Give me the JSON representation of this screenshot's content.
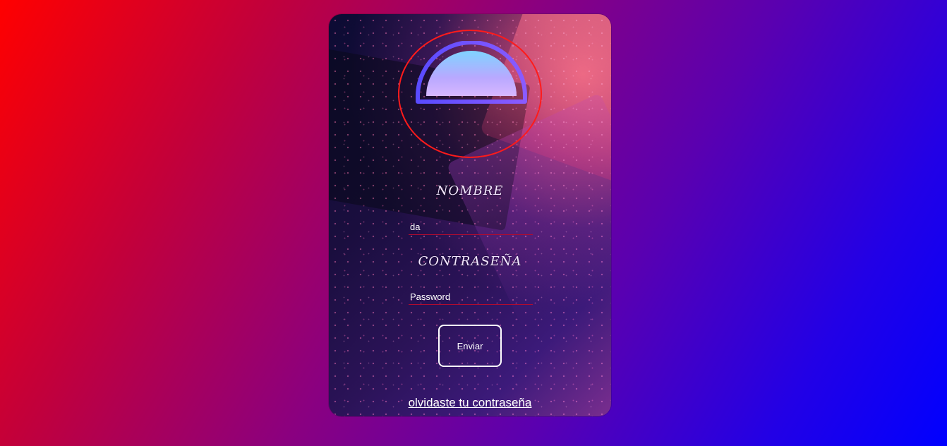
{
  "form": {
    "user_label": "NOMBRE",
    "user_value": "da",
    "password_label": "CONTRASEÑA",
    "password_placeholder": "Password",
    "submit_label": "Enviar",
    "forgot_link": "olvidaste tu contraseña"
  },
  "colors": {
    "background_left": "#ff0000",
    "background_right": "#0000ff",
    "logo_ring": "#ff1b1b",
    "input_underline": "#b10b2f",
    "text": "#ffffff"
  },
  "icons": {
    "logo": "sunset-logo-icon"
  }
}
